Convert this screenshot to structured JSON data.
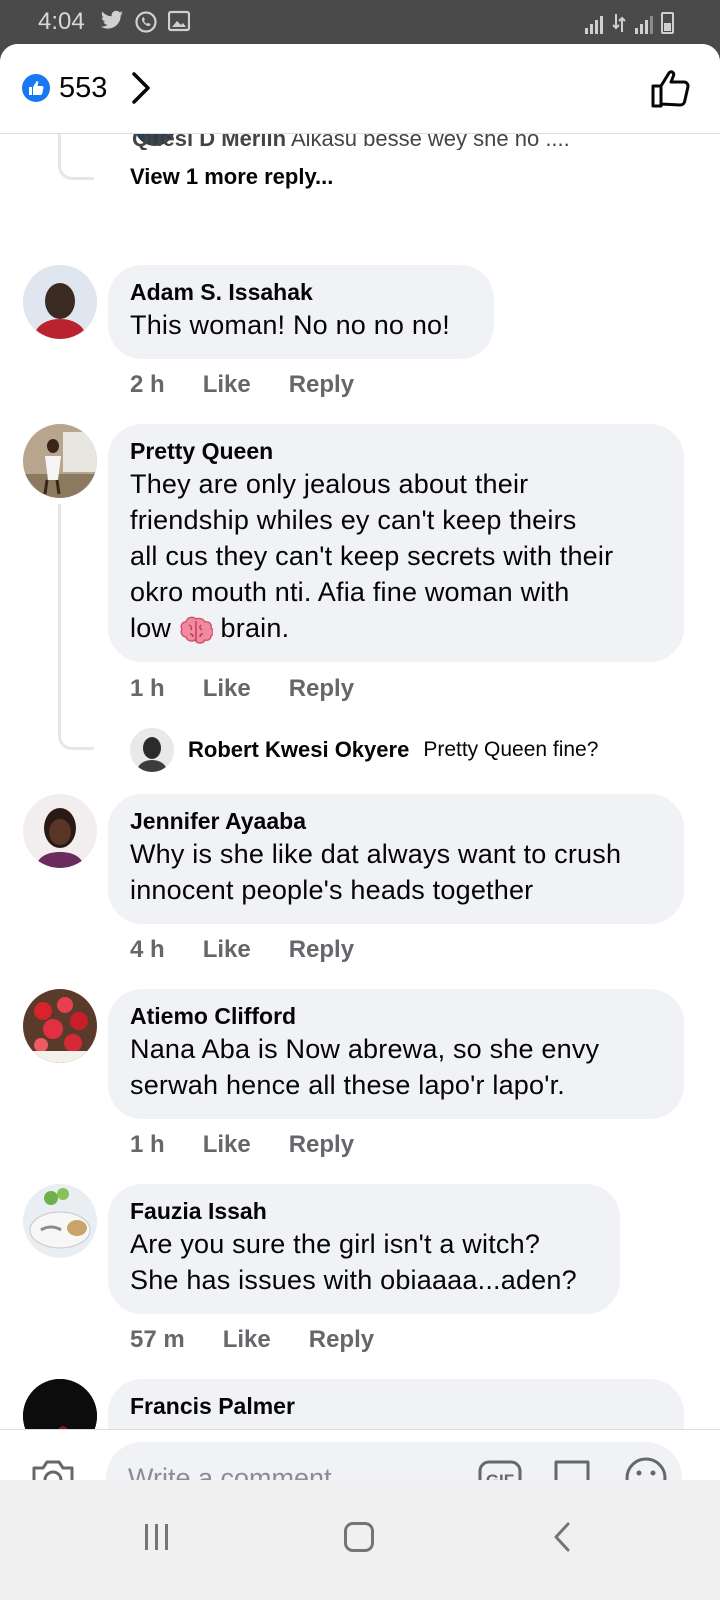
{
  "status": {
    "time": "4:04"
  },
  "header": {
    "like_count": "553"
  },
  "thread": {
    "partial_reply_author": "Quesi D Merlin",
    "partial_reply_text": "Aikasu besse wey she no ....",
    "view_more": "View 1 more reply..."
  },
  "comments": [
    {
      "author": "Adam S. Issahak",
      "lines": [
        "This woman! No no no no!"
      ],
      "time": "2 h",
      "like": "Like",
      "reply": "Reply"
    },
    {
      "author": "Pretty Queen",
      "lines": [
        "They are only jealous about their",
        "friendship whiles ey can't keep theirs",
        "all cus they can't keep secrets with their",
        "okro mouth nti.  Afia fine woman with"
      ],
      "last_line_before": "low",
      "last_line_after": "brain.",
      "emoji": "brain",
      "time": "1 h",
      "like": "Like",
      "reply": "Reply",
      "reply_preview": {
        "author": "Robert Kwesi Okyere",
        "text": "Pretty Queen fine?"
      }
    },
    {
      "author": "Jennifer Ayaaba",
      "lines": [
        "Why is she like dat always want to crush",
        "innocent people's heads together"
      ],
      "time": "4 h",
      "like": "Like",
      "reply": "Reply"
    },
    {
      "author": "Atiemo Clifford",
      "lines": [
        "Nana Aba is Now abrewa, so she envy",
        "serwah hence all these lapo'r lapo'r."
      ],
      "time": "1 h",
      "like": "Like",
      "reply": "Reply"
    },
    {
      "author": "Fauzia Issah",
      "lines": [
        "Are you sure the girl isn't a witch?",
        "She has issues with obiaaaa...aden?"
      ],
      "time": "57 m",
      "like": "Like",
      "reply": "Reply"
    },
    {
      "author": "Francis Palmer"
    }
  ],
  "composer": {
    "placeholder": "Write a comment..."
  },
  "colors": {
    "accent": "#1877f2",
    "bubble": "#f0f2f5",
    "meta": "#65676b"
  }
}
